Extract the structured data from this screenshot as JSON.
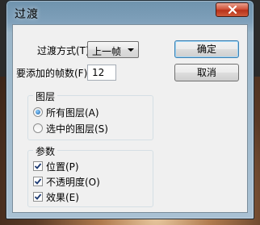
{
  "dialog": {
    "title": "过渡",
    "close_label": "×"
  },
  "form": {
    "method_label": "过渡方式(T):",
    "method_value": "上一帧",
    "frames_label": "要添加的帧数(F):",
    "frames_value": "12"
  },
  "buttons": {
    "ok": "确定",
    "cancel": "取消"
  },
  "layers_group": {
    "legend": "图层",
    "options": [
      {
        "label": "所有图层(A)",
        "selected": true
      },
      {
        "label": "选中的图层(S)",
        "selected": false
      }
    ]
  },
  "params_group": {
    "legend": "参数",
    "options": [
      {
        "label": "位置(P)",
        "checked": true
      },
      {
        "label": "不透明度(O)",
        "checked": true
      },
      {
        "label": "效果(E)",
        "checked": true
      }
    ]
  }
}
